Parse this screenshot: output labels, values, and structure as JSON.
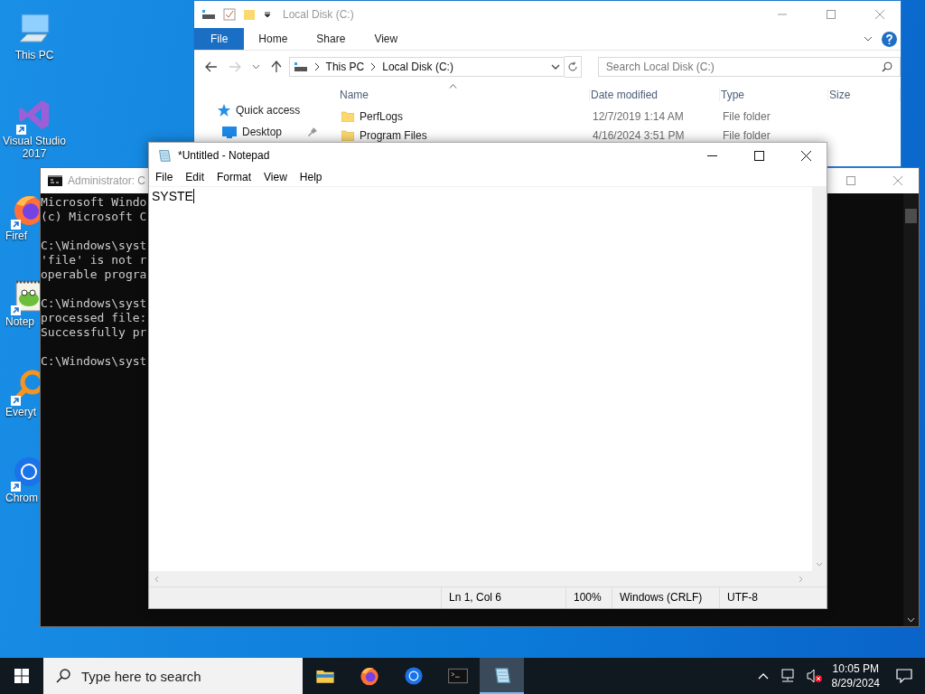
{
  "desktop_icons": [
    {
      "label": "This PC",
      "kind": "pc",
      "shortcut": false
    },
    {
      "label": "Visual Studio 2017",
      "kind": "vs",
      "shortcut": true
    },
    {
      "label": "Firef",
      "kind": "firefox",
      "shortcut": true
    },
    {
      "label": "Notep",
      "kind": "notepad",
      "shortcut": true
    },
    {
      "label": "Everyt",
      "kind": "everything",
      "shortcut": true
    },
    {
      "label": "Chrom",
      "kind": "chrome",
      "shortcut": true
    }
  ],
  "explorer": {
    "title": "Local Disk (C:)",
    "ribbon_tabs": [
      {
        "label": "File",
        "selected": true
      },
      {
        "label": "Home",
        "selected": false
      },
      {
        "label": "Share",
        "selected": false
      },
      {
        "label": "View",
        "selected": false
      }
    ],
    "address": [
      "This PC",
      "Local Disk (C:)"
    ],
    "search": {
      "placeholder": "Search Local Disk (C:)"
    },
    "columns": [
      "Name",
      "Date modified",
      "Type",
      "Size"
    ],
    "nav": [
      {
        "label": "Quick access",
        "kind": "star",
        "pinned": false
      },
      {
        "label": "Desktop",
        "kind": "desktop",
        "pinned": true
      }
    ],
    "rows": [
      {
        "name": "PerfLogs",
        "date": "12/7/2019 1:14 AM",
        "type": "File folder"
      },
      {
        "name": "Program Files",
        "date": "4/16/2024 3:51 PM",
        "type": "File folder"
      }
    ]
  },
  "cmd": {
    "title": "Administrator: C",
    "blocks": [
      [
        "Microsoft Windo",
        "(c) Microsoft C"
      ],
      [
        "C:\\Windows\\syst",
        "'file' is not r",
        "operable progra"
      ],
      [
        "C:\\Windows\\syst",
        "processed file:",
        "Successfully pr"
      ],
      [
        "C:\\Windows\\syst"
      ]
    ]
  },
  "notepad": {
    "title": "*Untitled - Notepad",
    "menu": [
      "File",
      "Edit",
      "Format",
      "View",
      "Help"
    ],
    "text": "SYSTE",
    "status": [
      "Ln 1, Col 6",
      "100%",
      "Windows (CRLF)",
      "UTF-8"
    ]
  },
  "taskbar": {
    "search": {
      "placeholder": "Type here to search"
    },
    "apps": [
      {
        "kind": "explorer",
        "selected": false
      },
      {
        "kind": "firefox",
        "selected": false
      },
      {
        "kind": "chrome",
        "selected": false
      },
      {
        "kind": "cmd",
        "selected": false
      },
      {
        "kind": "notepad",
        "selected": true
      }
    ],
    "time": "10:05 PM",
    "date": "8/29/2024"
  }
}
